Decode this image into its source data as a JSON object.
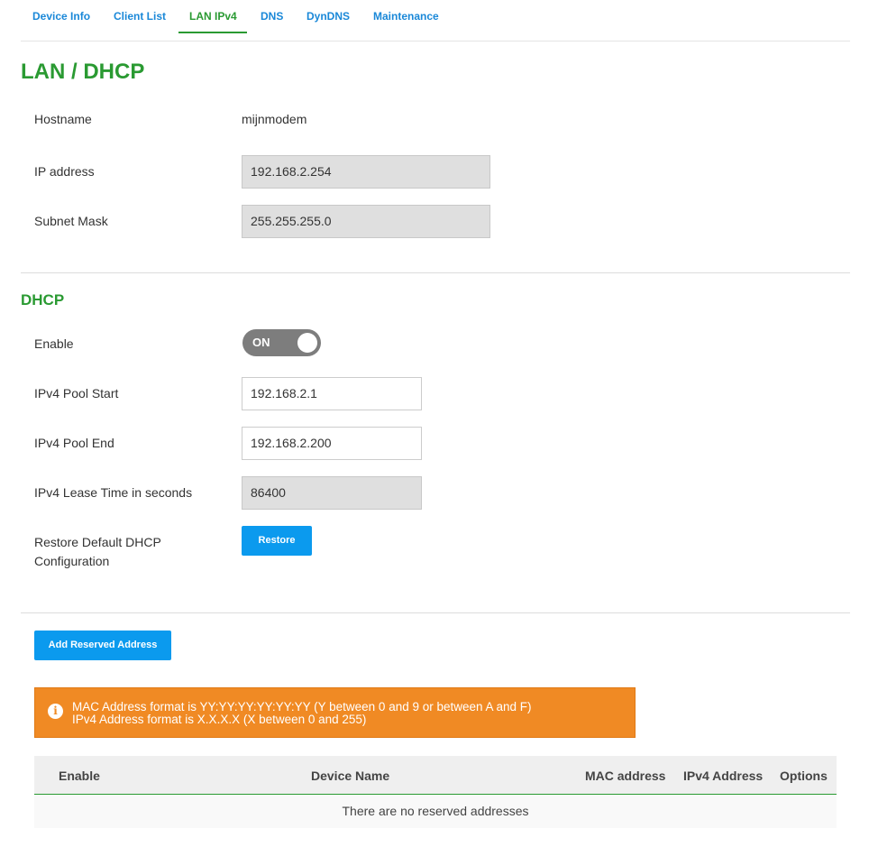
{
  "tabs": [
    {
      "label": "Device Info",
      "active": false
    },
    {
      "label": "Client List",
      "active": false
    },
    {
      "label": "LAN IPv4",
      "active": true
    },
    {
      "label": "DNS",
      "active": false
    },
    {
      "label": "DynDNS",
      "active": false
    },
    {
      "label": "Maintenance",
      "active": false
    }
  ],
  "lan": {
    "title": "LAN / DHCP",
    "hostname_label": "Hostname",
    "hostname_value": "mijnmodem",
    "ip_label": "IP address",
    "ip_value": "192.168.2.254",
    "subnet_label": "Subnet Mask",
    "subnet_value": "255.255.255.0"
  },
  "dhcp": {
    "title": "DHCP",
    "enable_label": "Enable",
    "enable_state": "ON",
    "pool_start_label": "IPv4 Pool Start",
    "pool_start_value": "192.168.2.1",
    "pool_end_label": "IPv4 Pool End",
    "pool_end_value": "192.168.2.200",
    "lease_label": "IPv4 Lease Time in seconds",
    "lease_value": "86400",
    "restore_label_line1": "Restore Default DHCP",
    "restore_label_line2": "Configuration",
    "restore_button": "Restore"
  },
  "reserved": {
    "add_button": "Add Reserved Address",
    "alert_line1": "MAC Address format is YY:YY:YY:YY:YY:YY (Y between 0 and 9 or between A and F)",
    "alert_line2": "IPv4 Address format is X.X.X.X (X between 0 and 255)",
    "columns": [
      "Enable",
      "Device Name",
      "MAC address",
      "IPv4 Address",
      "Options"
    ],
    "empty_message": "There are no reserved addresses"
  },
  "colors": {
    "accent_green": "#2a9a32",
    "link_blue": "#1a88d8",
    "button_blue": "#0b9aee",
    "alert_orange": "#f08a24"
  }
}
